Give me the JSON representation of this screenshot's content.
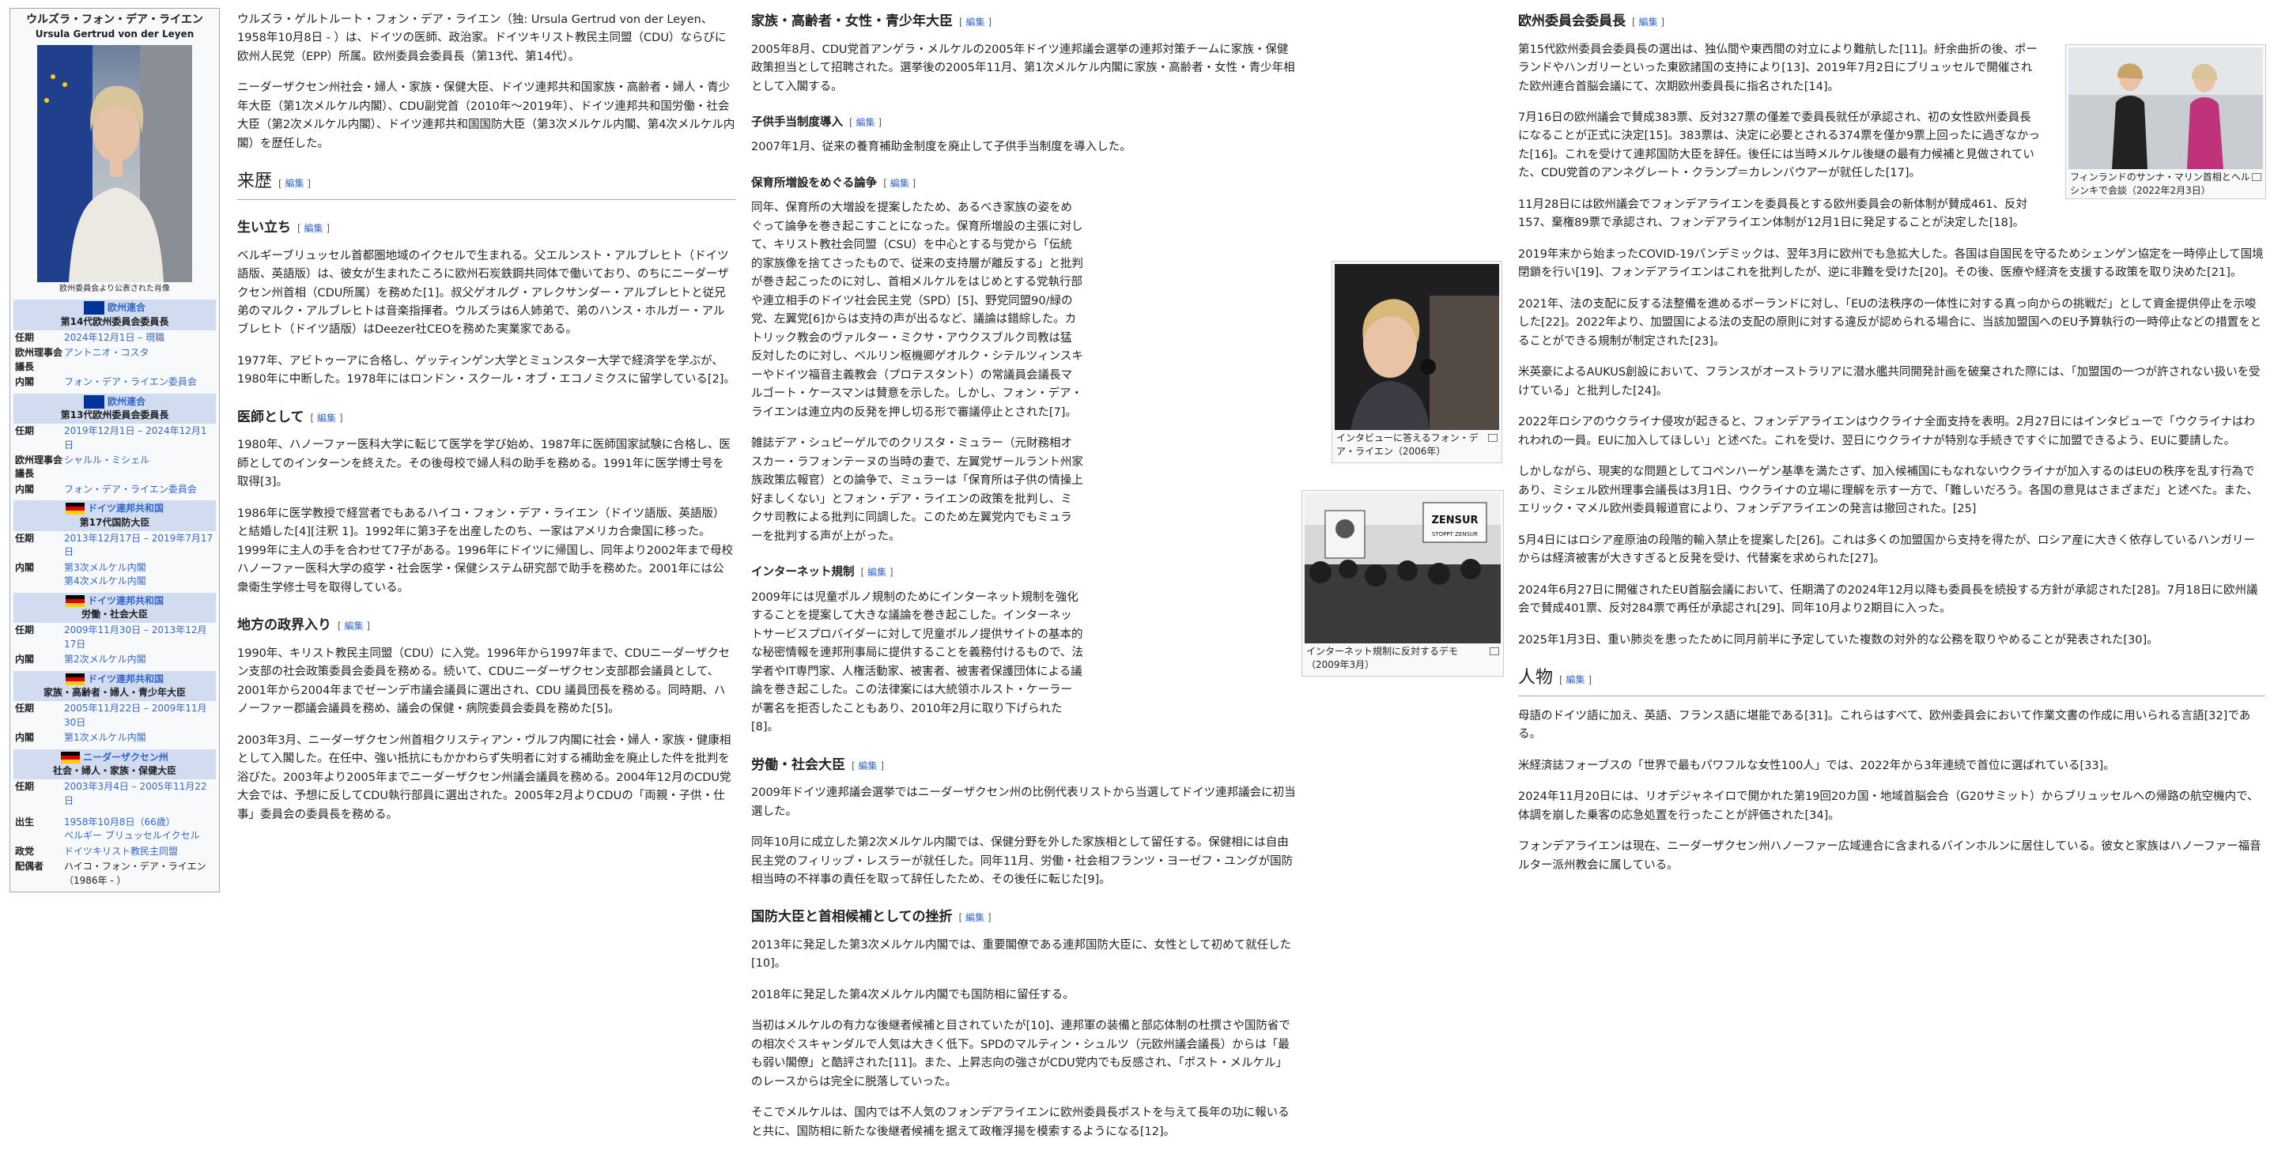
{
  "infobox": {
    "title": "ウルズラ・フォン・デア・ライエン",
    "subtitle": "Ursula Gertrud von der Leyen",
    "photo_caption": "欧州委員会より公表された肖像",
    "offices": [
      {
        "flag": "eu",
        "lines": [
          "欧州連合",
          "第14代欧州委員会委員長"
        ],
        "rows": [
          [
            "任期",
            "2024年12月1日 – 現職"
          ],
          [
            "欧州理事会議長",
            "アントニオ・コスタ"
          ],
          [
            "内閣",
            "フォン・デア・ライエン委員会"
          ]
        ]
      },
      {
        "flag": "eu",
        "lines": [
          "欧州連合",
          "第13代欧州委員会委員長"
        ],
        "rows": [
          [
            "任期",
            "2019年12月1日 – 2024年12月1日"
          ],
          [
            "欧州理事会議長",
            "シャルル・ミシェル"
          ],
          [
            "内閣",
            "フォン・デア・ライエン委員会"
          ]
        ]
      },
      {
        "flag": "de",
        "lines": [
          "ドイツ連邦共和国",
          "第17代国防大臣"
        ],
        "rows": [
          [
            "任期",
            "2013年12月17日 – 2019年7月17日"
          ],
          [
            "内閣",
            "第3次メルケル内閣\n第4次メルケル内閣"
          ]
        ]
      },
      {
        "flag": "de",
        "lines": [
          "ドイツ連邦共和国",
          "労働・社会大臣"
        ],
        "rows": [
          [
            "任期",
            "2009年11月30日 – 2013年12月17日"
          ],
          [
            "内閣",
            "第2次メルケル内閣"
          ]
        ]
      },
      {
        "flag": "de",
        "lines": [
          "ドイツ連邦共和国",
          "家族・高齢者・婦人・青少年大臣"
        ],
        "rows": [
          [
            "任期",
            "2005年11月22日 – 2009年11月30日"
          ],
          [
            "内閣",
            "第1次メルケル内閣"
          ]
        ]
      },
      {
        "flag": "de",
        "lines": [
          "ニーダーザクセン州",
          "社会・婦人・家族・保健大臣"
        ],
        "rows": [
          [
            "任期",
            "2003年3月4日 – 2005年11月22日"
          ]
        ]
      }
    ],
    "personal": [
      [
        "出生",
        "1958年10月8日（66歳）\nベルギー ブリュッセルイクセル"
      ],
      [
        "政党",
        "ドイツキリスト教民主同盟"
      ],
      [
        "配偶者",
        "ハイコ・フォン・デア・ライエン\n（1986年 - ）"
      ]
    ]
  },
  "edit_label": "編集",
  "col1": {
    "intro": [
      "ウルズラ・ゲルトルート・フォン・デア・ライエン（独: Ursula Gertrud von der Leyen、1958年10月8日 - ）は、ドイツの医師、政治家。ドイツキリスト教民主同盟（CDU）ならびに欧州人民党（EPP）所属。欧州委員会委員長（第13代、第14代）。",
      "ニーダーザクセン州社会・婦人・家族・保健大臣、ドイツ連邦共和国家族・高齢者・婦人・青少年大臣（第1次メルケル内閣）、CDU副党首（2010年〜2019年）、ドイツ連邦共和国労働・社会大臣（第2次メルケル内閣）、ドイツ連邦共和国国防大臣（第3次メルケル内閣、第4次メルケル内閣）を歴任した。"
    ],
    "h2_career": "来歴",
    "h3_birth": "生い立ち",
    "birth": [
      "ベルギーブリュッセル首都圏地域のイクセルで生まれる。父エルンスト・アルブレヒト（ドイツ語版、英語版）は、彼女が生まれたころに欧州石炭鉄鋼共同体で働いており、のちにニーダーザクセン州首相（CDU所属）を務めた[1]。叔父ゲオルグ・アレクサンダー・アルブレヒトと従兄弟のマルク・アルブレヒトは音楽指揮者。ウルズラは6人姉弟で、弟のハンス・ホルガー・アルブレヒト（ドイツ語版）はDeezer社CEOを務めた実業家である。",
      "1977年、アビトゥーアに合格し、ゲッティンゲン大学とミュンスター大学で経済学を学ぶが、1980年に中断した。1978年にはロンドン・スクール・オブ・エコノミクスに留学している[2]。"
    ],
    "h3_doctor": "医師として",
    "doctor": [
      "1980年、ハノーファー医科大学に転じて医学を学び始め、1987年に医師国家試験に合格し、医師としてのインターンを終えた。その後母校で婦人科の助手を務める。1991年に医学博士号を取得[3]。",
      "1986年に医学教授で経営者でもあるハイコ・フォン・デア・ライエン（ドイツ語版、英語版）と結婚した[4][注釈 1]。1992年に第3子を出産したのち、一家はアメリカ合衆国に移った。1999年に主人の手を合わせて7子がある。1996年にドイツに帰国し、同年より2002年まで母校ハノーファー医科大学の疫学・社会医学・保健システム研究部で助手を務めた。2001年には公衆衛生学修士号を取得している。"
    ],
    "h3_local": "地方の政界入り",
    "local": [
      "1990年、キリスト教民主同盟（CDU）に入党。1996年から1997年まで、CDUニーダーザクセン支部の社会政策委員会委員を務める。続いて、CDUニーダーザクセン支部郡会議員として、2001年から2004年までゼーンデ市議会議員に選出され、CDU 議員団長を務める。同時期、ハノーファー郡議会議員を務め、議会の保健・病院委員会委員を務めた[5]。",
      "2003年3月、ニーダーザクセン州首相クリスティアン・ヴルフ内閣に社会・婦人・家族・健康相として入閣した。在任中、強い抵抗にもかかわらず失明者に対する補助金を廃止した件を批判を浴びた。2003年より2005年までニーダーザクセン州議会議員を務める。2004年12月のCDU党大会では、予想に反してCDU執行部員に選出された。2005年2月よりCDUの「両親・子供・仕事」委員会の委員長を務める。"
    ]
  },
  "col2": {
    "h3_family": "家族・高齢者・女性・青少年大臣",
    "family": "2005年8月、CDU党首アンゲラ・メルケルの2005年ドイツ連邦議会選挙の連邦対策チームに家族・保健政策担当として招聘された。選挙後の2005年11月、第1次メルケル内閣に家族・高齢者・女性・青少年相として入閣する。",
    "h4_allowance": "子供手当制度導入",
    "allowance": "2007年1月、従来の養育補助金制度を廃止して子供手当制度を導入した。",
    "h4_daycare": "保育所増設をめぐる論争",
    "daycare": [
      "同年、保育所の大増設を提案したため、あるべき家族の姿をめぐって論争を巻き起こすことになった。保育所増設の主張に対して、キリスト教社会同盟（CSU）を中心とする与党から「伝統的家族像を捨てさったもので、従来の支持層が離反する」と批判が巻き起こったのに対し、首相メルケルをはじめとする党執行部や連立相手のドイツ社会民主党（SPD）[5]、野党同盟90/緑の党、左翼党[6]からは支持の声が出るなど、議論は錯綜した。カトリック教会のヴァルター・ミクサ・アウクスブルク司教は猛反対したのに対し、ベルリン枢機卿ゲオルク・シテルツィンスキーやドイツ福音主義教会（プロテスタント）の常議員会議長マルゴート・ケースマンは賛意を示した。しかし、フォン・デア・ライエンは連立内の反発を押し切る形で審議停止とされた[7]。",
      "雑誌デア・シュピーゲルでのクリスタ・ミュラー（元財務相オスカー・ラフォンテーヌの当時の妻で、左翼党ザールラント州家族政策広報官）との論争で、ミュラーは「保育所は子供の情操上好ましくない」とフォン・デア・ライエンの政策を批判し、ミクサ司教による批判に同調した。このため左翼党内でもミュラーを批判する声が上がった。"
    ],
    "h4_internet": "インターネット規制",
    "internet": "2009年には児童ポルノ規制のためにインターネット規制を強化することを提案して大きな議論を巻き起こした。インターネットサービスプロバイダーに対して児童ポルノ提供サイトの基本的な秘密情報を連邦刑事局に提供することを義務付けるもので、法学者やIT専門家、人権活動家、被害者、被害者保護団体による議論を巻き起こした。この法律案には大統領ホルスト・ケーラーが署名を拒否したこともあり、2010年2月に取り下げられた[8]。",
    "h3_labour": "労働・社会大臣",
    "labour": [
      "2009年ドイツ連邦議会選挙ではニーダーザクセン州の比例代表リストから当選してドイツ連邦議会に初当選した。",
      "同年10月に成立した第2次メルケル内閣では、保健分野を外した家族相として留任する。保健相には自由民主党のフィリップ・レスラーが就任した。同年11月、労働・社会相フランツ・ヨーゼフ・ユングが国防相当時の不祥事の責任を取って辞任したため、その後任に転じた[9]。"
    ],
    "h3_defense": "国防大臣と首相候補としての挫折",
    "defense": [
      "2013年に発足した第3次メルケル内閣では、重要閣僚である連邦国防大臣に、女性として初めて就任した[10]。",
      "2018年に発足した第4次メルケル内閣でも国防相に留任する。",
      "当初はメルケルの有力な後継者候補と目されていたが[10]、連邦軍の装備と部応体制の杜撰さや国防省での相次ぐスキャンダルで人気は大きく低下。SPDのマルティン・シュルツ（元欧州議会議長）からは「最も弱い閣僚」と酷評された[11]。また、上昇志向の強さがCDU党内でも反感され、「ポスト・メルケル」のレースからは完全に脱落していった。",
      "そこでメルケルは、国内では不人気のフォンデアライエンに欧州委員長ポストを与えて長年の功に報いると共に、国防相に新たな後継者候補を据えて政権浮揚を模索するようになる[12]。"
    ]
  },
  "thumb1": {
    "caption": "インタビューに答えるフォン・デア・ライエン（2006年）"
  },
  "thumb2": {
    "caption": "インターネット規制に反対するデモ（2009年3月）",
    "sign1": "ZENSUR",
    "sign2": "STOPPT ZENSUR"
  },
  "thumb3": {
    "caption": "フィンランドのサンナ・マリン首相とヘルシンキで会談（2022年2月3日）"
  },
  "col3": {
    "h3_pres": "欧州委員会委員長",
    "pres": [
      "第15代欧州委員会委員長の選出は、独仏間や東西間の対立により難航した[11]。紆余曲折の後、ポーランドやハンガリーといった東欧諸国の支持により[13]、2019年7月2日にブリュッセルで開催された欧州連合首脳会議にて、次期欧州委員長に指名された[14]。",
      "7月16日の欧州議会で賛成383票、反対327票の僅差で委員長就任が承認され、初の女性欧州委員長になることが正式に決定[15]。383票は、決定に必要とされる374票を僅か9票上回ったに過ぎなかった[16]。これを受けて連邦国防大臣を辞任。後任には当時メルケル後継の最有力候補と見做されていた、CDU党首のアンネグレート・クランプ＝カレンバウアーが就任した[17]。",
      "11月28日には欧州議会でフォンデアライエンを委員長とする欧州委員会の新体制が賛成461、反対157、棄権89票で承認され、フォンデアライエン体制が12月1日に発足することが決定した[18]。",
      "2019年末から始まったCOVID-19パンデミックは、翌年3月に欧州でも急拡大した。各国は自国民を守るためシェンゲン協定を一時停止して国境閉鎖を行い[19]、フォンデアライエンはこれを批判したが、逆に非難を受けた[20]。その後、医療や経済を支援する政策を取り決めた[21]。",
      "2021年、法の支配に反する法整備を進めるポーランドに対し、「EUの法秩序の一体性に対する真っ向からの挑戦だ」として資金提供停止を示唆した[22]。2022年より、加盟国による法の支配の原則に対する違反が認められる場合に、当該加盟国へのEU予算執行の一時停止などの措置をとることができる規制が制定された[23]。",
      "米英豪によるAUKUS創設において、フランスがオーストラリアに潜水艦共同開発計画を破棄された際には、「加盟国の一つが許されない扱いを受けている」と批判した[24]。",
      "2022年ロシアのウクライナ侵攻が起きると、フォンデアライエンはウクライナ全面支持を表明。2月27日にはインタビューで「ウクライナはわれわれの一員。EUに加入してほしい」と述べた。これを受け、翌日にウクライナが特別な手続きですぐに加盟できるよう、EUに要請した。",
      "しかしながら、現実的な問題としてコペンハーゲン基準を満たさず、加入候補国にもなれないウクライナが加入するのはEUの秩序を乱す行為であり、ミシェル欧州理事会議長は3月1日、ウクライナの立場に理解を示す一方で、「難しいだろう。各国の意見はさまざまだ」と述べた。また、エリック・マメル欧州委員報道官により、フォンデアライエンの発言は撤回された。[25]",
      "5月4日にはロシア産原油の段階的輸入禁止を提案した[26]。これは多くの加盟国から支持を得たが、ロシア産に大きく依存しているハンガリーからは経済被害が大きすぎると反発を受け、代替案を求められた[27]。",
      "2024年6月27日に開催されたEU首脳会議において、任期満了の2024年12月以降も委員長を続投する方針が承認された[28]。7月18日に欧州議会で賛成401票、反対284票で再任が承認され[29]、同年10月より2期目に入った。",
      "2025年1月3日、重い肺炎を患ったために同月前半に予定していた複数の対外的な公務を取りやめることが発表された[30]。"
    ],
    "h2_person": "人物",
    "person": [
      "母語のドイツ語に加え、英語、フランス語に堪能である[31]。これらはすべて、欧州委員会において作業文書の作成に用いられる言語[32]である。",
      "米経済誌フォーブスの「世界で最もパワフルな女性100人」では、2022年から3年連続で首位に選ばれている[33]。",
      "2024年11月20日には、リオデジャネイロで開かれた第19回20カ国・地域首脳会合（G20サミット）からブリュッセルへの帰路の航空機内で、体調を崩した乗客の応急処置を行ったことが評価された[34]。",
      "フォンデアライエンは現在、ニーダーザクセン州ハノーファー広域連合に含まれるバインホルンに居住している。彼女と家族はハノーファー福音ルター派州教会に属している。"
    ]
  }
}
